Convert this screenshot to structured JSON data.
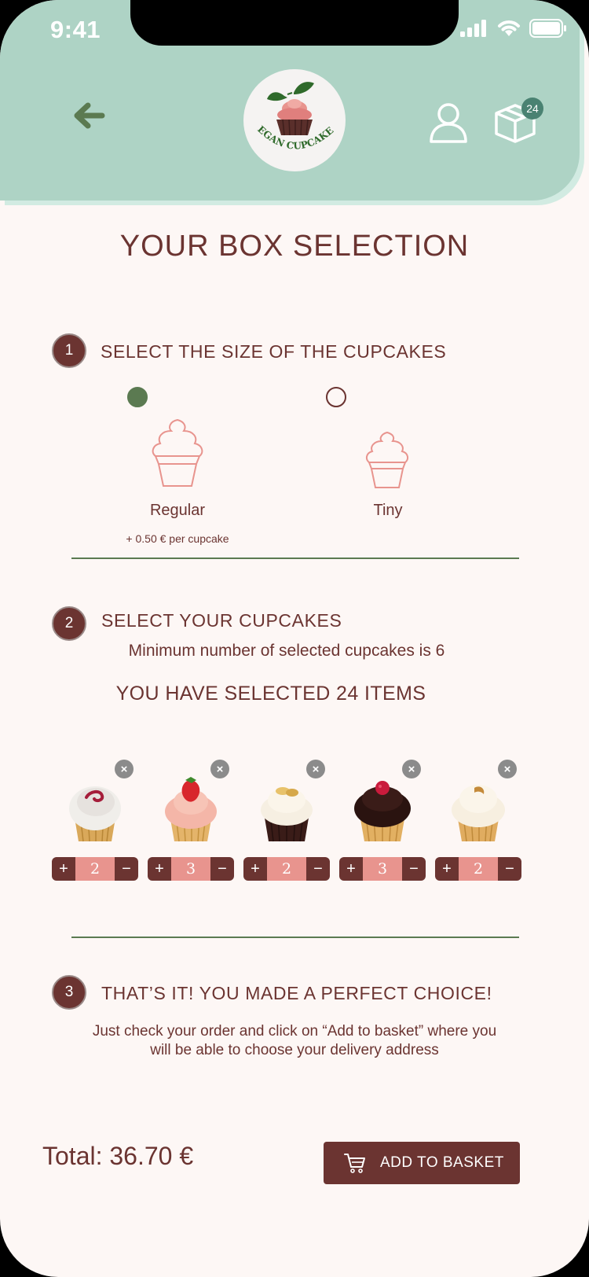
{
  "status_bar": {
    "time": "9:41"
  },
  "header": {
    "logo_text": "VEGAN CUPCAKES",
    "box_badge": "24"
  },
  "page_title": "YOUR BOX SELECTION",
  "step1": {
    "number": "1",
    "title": "SELECT THE SIZE OF THE CUPCAKES",
    "options": [
      {
        "label": "Regular",
        "note": "+ 0.50 € per cupcake",
        "selected": true
      },
      {
        "label": "Tiny",
        "note": "",
        "selected": false
      }
    ]
  },
  "step2": {
    "number": "2",
    "title": "SELECT YOUR CUPCAKES",
    "minimum_text": "Minimum number of selected cupcakes is 6",
    "selected_text": "YOU HAVE SELECTED 24 ITEMS",
    "items": [
      {
        "name": "red-velvet-swirl-cupcake",
        "qty": "2"
      },
      {
        "name": "strawberry-cupcake",
        "qty": "3"
      },
      {
        "name": "banana-chocolate-cupcake",
        "qty": "2"
      },
      {
        "name": "chocolate-raspberry-cupcake",
        "qty": "3"
      },
      {
        "name": "vanilla-caramel-cupcake",
        "qty": "2"
      }
    ],
    "plus_symbol": "+",
    "minus_symbol": "−",
    "remove_symbol": "×"
  },
  "step3": {
    "number": "3",
    "title": "THAT’S IT! YOU MADE A PERFECT CHOICE!",
    "info_text": "Just check your order and click on “Add to basket” where  you will be able to choose your delivery address"
  },
  "footer": {
    "total": "Total: 36.70 €",
    "add_button": "ADD TO BASKET"
  },
  "colors": {
    "header_bg": "#aed3c5",
    "page_bg": "#fdf7f5",
    "brand_brown": "#6b3431",
    "accent_green": "#5b7a51",
    "stepper_pink": "#e8948e",
    "badge_green": "#4a8272"
  }
}
